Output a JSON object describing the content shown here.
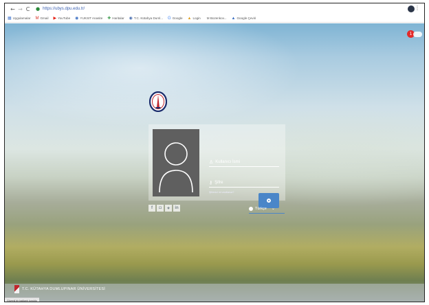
{
  "browser": {
    "url": "https://ubys.dpu.edu.tr/",
    "nav": {
      "back": "←",
      "forward": "→",
      "reload": "C"
    },
    "bookmarks": [
      {
        "icon": "▦",
        "label": "Uygulamalar",
        "color": "#4a7bd0"
      },
      {
        "icon": "M",
        "label": "Gmail",
        "color": "#d93025"
      },
      {
        "icon": "▶",
        "label": "YouTube",
        "color": "#e62117"
      },
      {
        "icon": "◉",
        "label": "YUKSIT Anasite",
        "color": "#3b6fc2"
      },
      {
        "icon": "✚",
        "label": "Haritalar",
        "color": "#3a9b4a"
      },
      {
        "icon": "◉",
        "label": "T.C. Kütahya Duml...",
        "color": "#4a6fb0"
      },
      {
        "icon": "G",
        "label": "Google",
        "color": "#4285f4"
      },
      {
        "icon": "▲",
        "label": "Login",
        "color": "#e0a020"
      },
      {
        "icon": "",
        "label": "M Bozenkov...",
        "color": "#777"
      },
      {
        "icon": "▲",
        "label": "Google Çeviri",
        "color": "#3b6fc2"
      }
    ]
  },
  "notifications": {
    "count": "1"
  },
  "login": {
    "username_placeholder": "Kullanıcı İsmi",
    "password_placeholder": "Şifre",
    "forgot_text": "Şifrenizi mi unuttunuz?"
  },
  "socials": [
    "f",
    "◘",
    "✦",
    "in"
  ],
  "language": {
    "selected": "Türkçe"
  },
  "footer": {
    "university": "T.C. KÜTAHYA DUMLUPINAR ÜNİVERSİTESİ"
  },
  "status_bar": {
    "text": "Güvenli bir bağlantı kuruldu"
  },
  "colors": {
    "accent": "#4a86c8",
    "badge": "#e32a2a",
    "avatar_bg": "#5f5f5f"
  }
}
